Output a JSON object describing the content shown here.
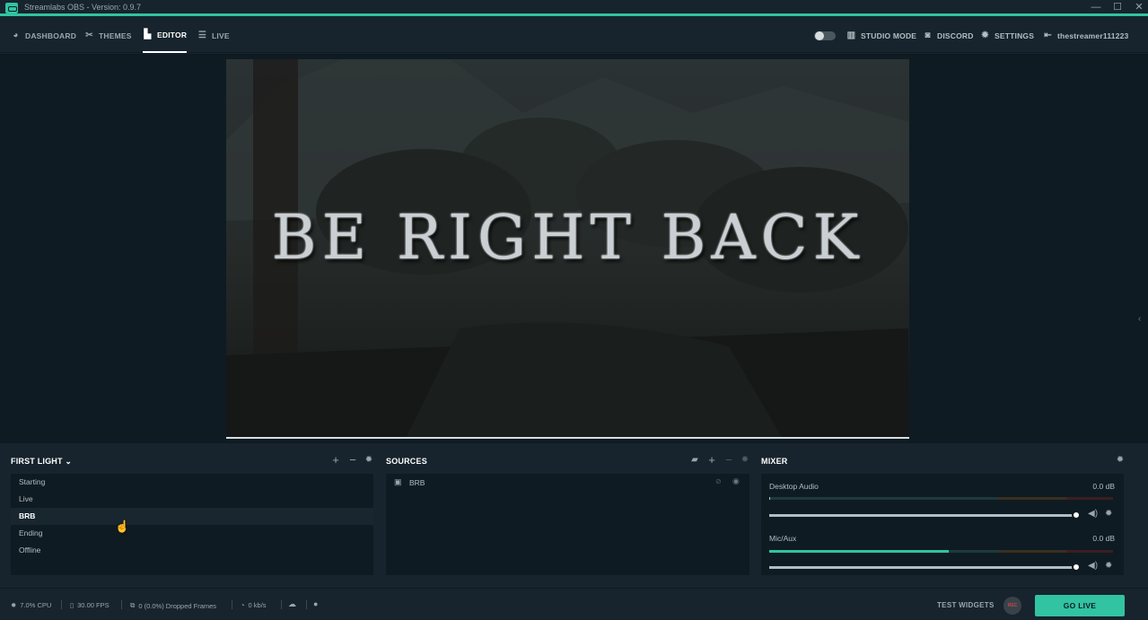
{
  "app": {
    "title": "Streamlabs OBS - Version: 0.9.7"
  },
  "window_controls": {
    "minimize": "—",
    "maximize": "☐",
    "close": "✕"
  },
  "nav": {
    "left": [
      {
        "label": "DASHBOARD",
        "icon": "dashboard-icon",
        "glyph": "◕"
      },
      {
        "label": "THEMES",
        "icon": "themes-icon",
        "glyph": "✂"
      },
      {
        "label": "EDITOR",
        "icon": "editor-icon",
        "glyph": "▙",
        "active": true
      },
      {
        "label": "LIVE",
        "icon": "live-icon",
        "glyph": "☰"
      }
    ],
    "right": [
      {
        "label": "STUDIO MODE",
        "icon": "studio-mode-icon",
        "glyph": "▥"
      },
      {
        "label": "DISCORD",
        "icon": "discord-icon",
        "glyph": "◙"
      },
      {
        "label": "SETTINGS",
        "icon": "settings-icon",
        "glyph": "✹"
      },
      {
        "label": "thestreamer111223",
        "icon": "logout-icon",
        "glyph": "⇤"
      }
    ]
  },
  "preview": {
    "overlay_text": "BE RIGHT BACK"
  },
  "scenes": {
    "title": "FIRST LIGHT",
    "items": [
      "Starting",
      "Live",
      "BRB",
      "Ending",
      "Offline"
    ],
    "selected": "BRB"
  },
  "sources": {
    "title": "SOURCES",
    "items": [
      {
        "label": "BRB",
        "icon": "image-icon"
      }
    ]
  },
  "mixer": {
    "title": "MIXER",
    "channels": [
      {
        "name": "Desktop Audio",
        "db": "0.0 dB",
        "level": 0.0,
        "volume": 0.9
      },
      {
        "name": "Mic/Aux",
        "db": "0.0 dB",
        "level": 0.52,
        "volume": 0.9
      }
    ]
  },
  "footer": {
    "cpu": "7.0% CPU",
    "fps": "30.00 FPS",
    "dropped": "0 (0.0%) Dropped Frames",
    "bandwidth": "0 kb/s",
    "test_widgets": "TEST WIDGETS",
    "rec": "REC",
    "go_live": "GO LIVE"
  },
  "colors": {
    "accent": "#31c3a2",
    "background": "#17242d",
    "panel": "#0f1b22"
  }
}
